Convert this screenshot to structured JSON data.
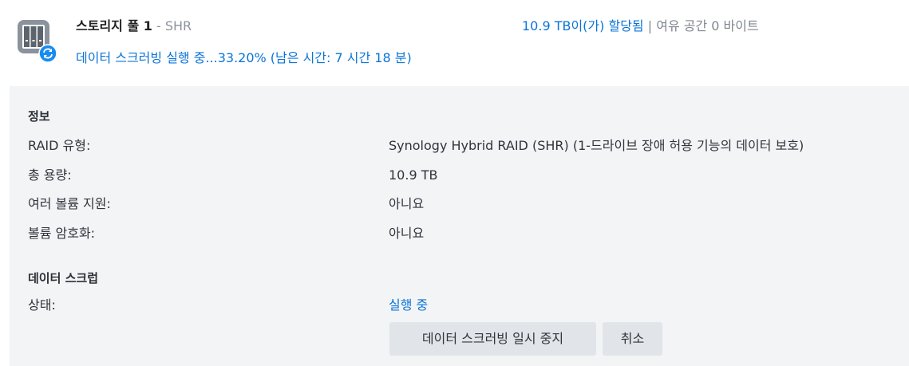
{
  "pool": {
    "title": "스토리지 풀 1",
    "separator": "-",
    "raid": "SHR",
    "status": "데이터 스크러빙 실행 중...33.20% (남은 시간: 7 시간 18 분)",
    "allocated": "10.9 TB이(가) 할당됨",
    "divider": "|",
    "free": "여유 공간 0 바이트",
    "icon": "storage-pool-icon",
    "badge_icon": "sync-icon",
    "accent_color": "#0a74d8"
  },
  "info": {
    "heading": "정보",
    "rows": [
      {
        "label": "RAID 유형:",
        "value": "Synology Hybrid RAID (SHR) (1-드라이브 장애 허용 기능의 데이터 보호)"
      },
      {
        "label": "총 용량:",
        "value": "10.9 TB"
      },
      {
        "label": "여러 볼륨 지원:",
        "value": "아니요"
      },
      {
        "label": "볼륨 암호화:",
        "value": "아니요"
      }
    ]
  },
  "scrub": {
    "heading": "데이터 스크럽",
    "status_label": "상태:",
    "status_value": "실행 중",
    "pause_button": "데이터 스크러빙 일시 중지",
    "cancel_button": "취소"
  }
}
